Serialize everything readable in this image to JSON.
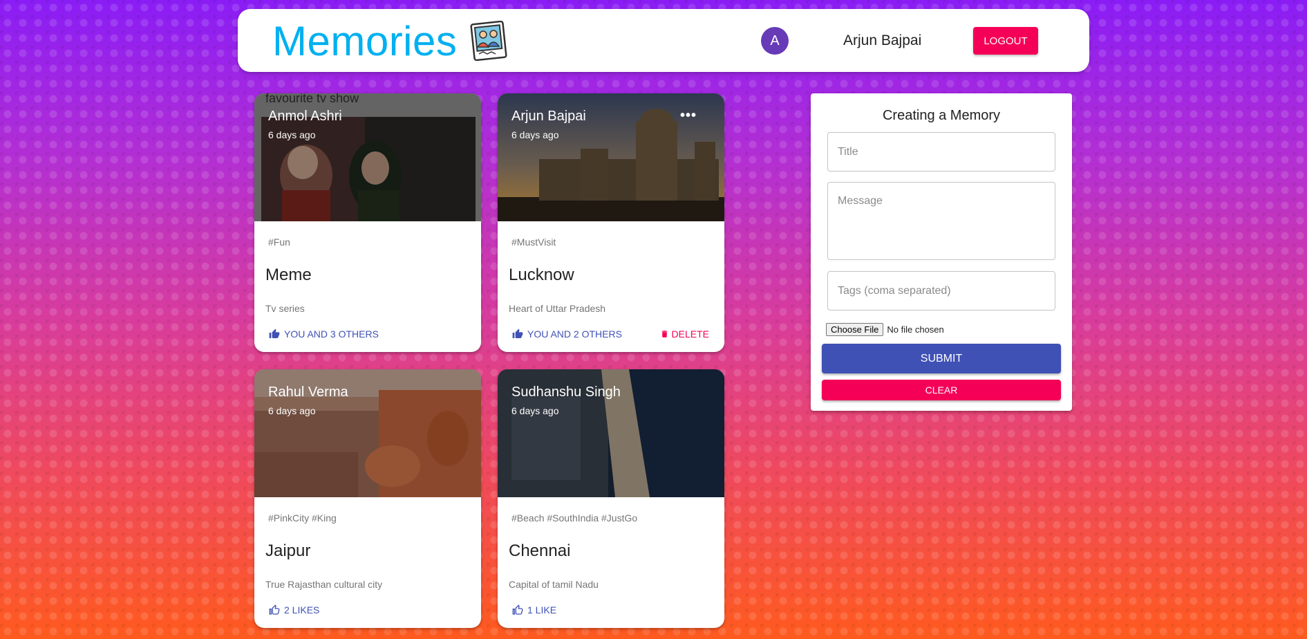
{
  "app": {
    "title": "Memories",
    "logo_icon": "memories-logo-icon"
  },
  "user": {
    "avatar_letter": "A",
    "name": "Arjun Bajpai",
    "logout_label": "LOGOUT"
  },
  "posts": [
    {
      "media_caption": "favourite tv show",
      "author": "Anmol Ashri",
      "time": "6 days ago",
      "tags": "#Fun",
      "title": "Meme",
      "message": "Tv series",
      "likes": "YOU AND 3 OTHERS"
    },
    {
      "author": "Arjun Bajpai",
      "time": "6 days ago",
      "more_icon": "•••",
      "tags": "#MustVisit",
      "title": "Lucknow",
      "message": "Heart of Uttar Pradesh",
      "likes": "YOU AND 2 OTHERS",
      "delete_label": "DELETE"
    },
    {
      "author": "Rahul Verma",
      "time": "6 days ago",
      "tags": "#PinkCity #King",
      "title": "Jaipur",
      "message": "True Rajasthan cultural city",
      "likes": "2 LIKES"
    },
    {
      "author": "Sudhanshu Singh",
      "time": "6 days ago",
      "tags": "#Beach #SouthIndia #JustGo",
      "title": "Chennai",
      "message": "Capital of tamil Nadu",
      "likes": "1 LIKE"
    }
  ],
  "form": {
    "heading": "Creating a Memory",
    "title_placeholder": "Title",
    "message_placeholder": "Message",
    "tags_placeholder": "Tags (coma separated)",
    "file_button": "Choose File",
    "file_status": "No file chosen",
    "submit_label": "SUBMIT",
    "clear_label": "CLEAR"
  },
  "colors": {
    "brand": "#00b0f0",
    "primary": "#3f51b5",
    "secondary": "#f50057",
    "avatar": "#673ab7"
  }
}
